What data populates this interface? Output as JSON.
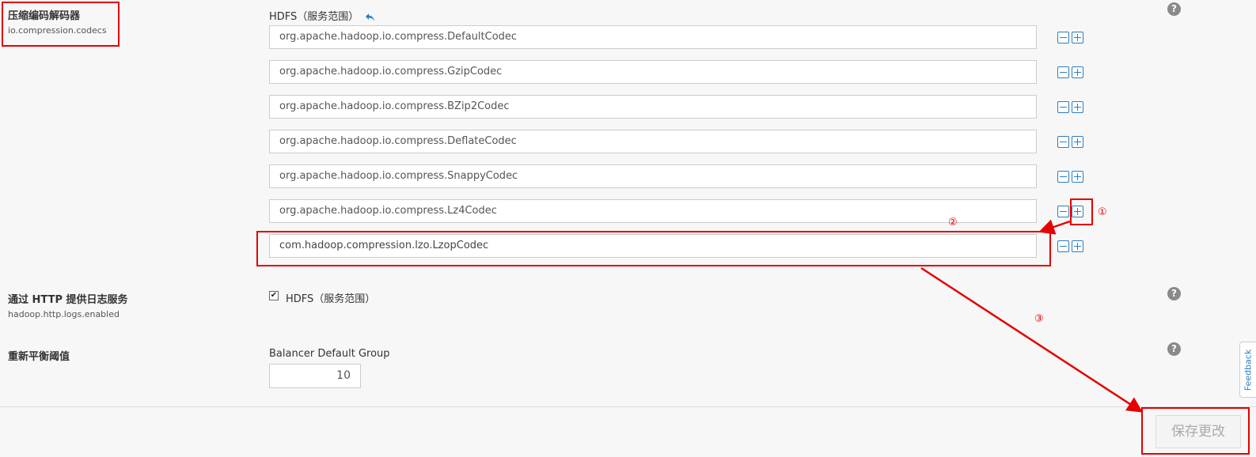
{
  "compression": {
    "title": "压缩编码解码器",
    "key": "io.compression.codecs",
    "scope_label": "HDFS（服务范围）",
    "values": [
      "org.apache.hadoop.io.compress.DefaultCodec",
      "org.apache.hadoop.io.compress.GzipCodec",
      "org.apache.hadoop.io.compress.BZip2Codec",
      "org.apache.hadoop.io.compress.DeflateCodec",
      "org.apache.hadoop.io.compress.SnappyCodec",
      "org.apache.hadoop.io.compress.Lz4Codec",
      "com.hadoop.compression.lzo.LzopCodec"
    ]
  },
  "http_logs": {
    "title": "通过 HTTP 提供日志服务",
    "key": "hadoop.http.logs.enabled",
    "checkbox_label": "HDFS（服务范围）",
    "checked": true
  },
  "rebalance": {
    "title": "重新平衡阈值",
    "group_label": "Balancer Default Group",
    "value": "10"
  },
  "annotations": {
    "step1": "①",
    "step2": "②",
    "step3": "③"
  },
  "icons": {
    "help": "help-icon",
    "undo": "undo-icon",
    "remove": "minus-icon",
    "add": "plus-icon",
    "check": "checkbox-checked-icon"
  },
  "help_glyph": "?",
  "footer": {
    "save_label": "保存更改"
  },
  "feedback": {
    "label": "Feedback"
  },
  "colors": {
    "accent": "#2d7dbf",
    "annotation_red": "#e60000",
    "help_gray": "#8a8a8a"
  }
}
